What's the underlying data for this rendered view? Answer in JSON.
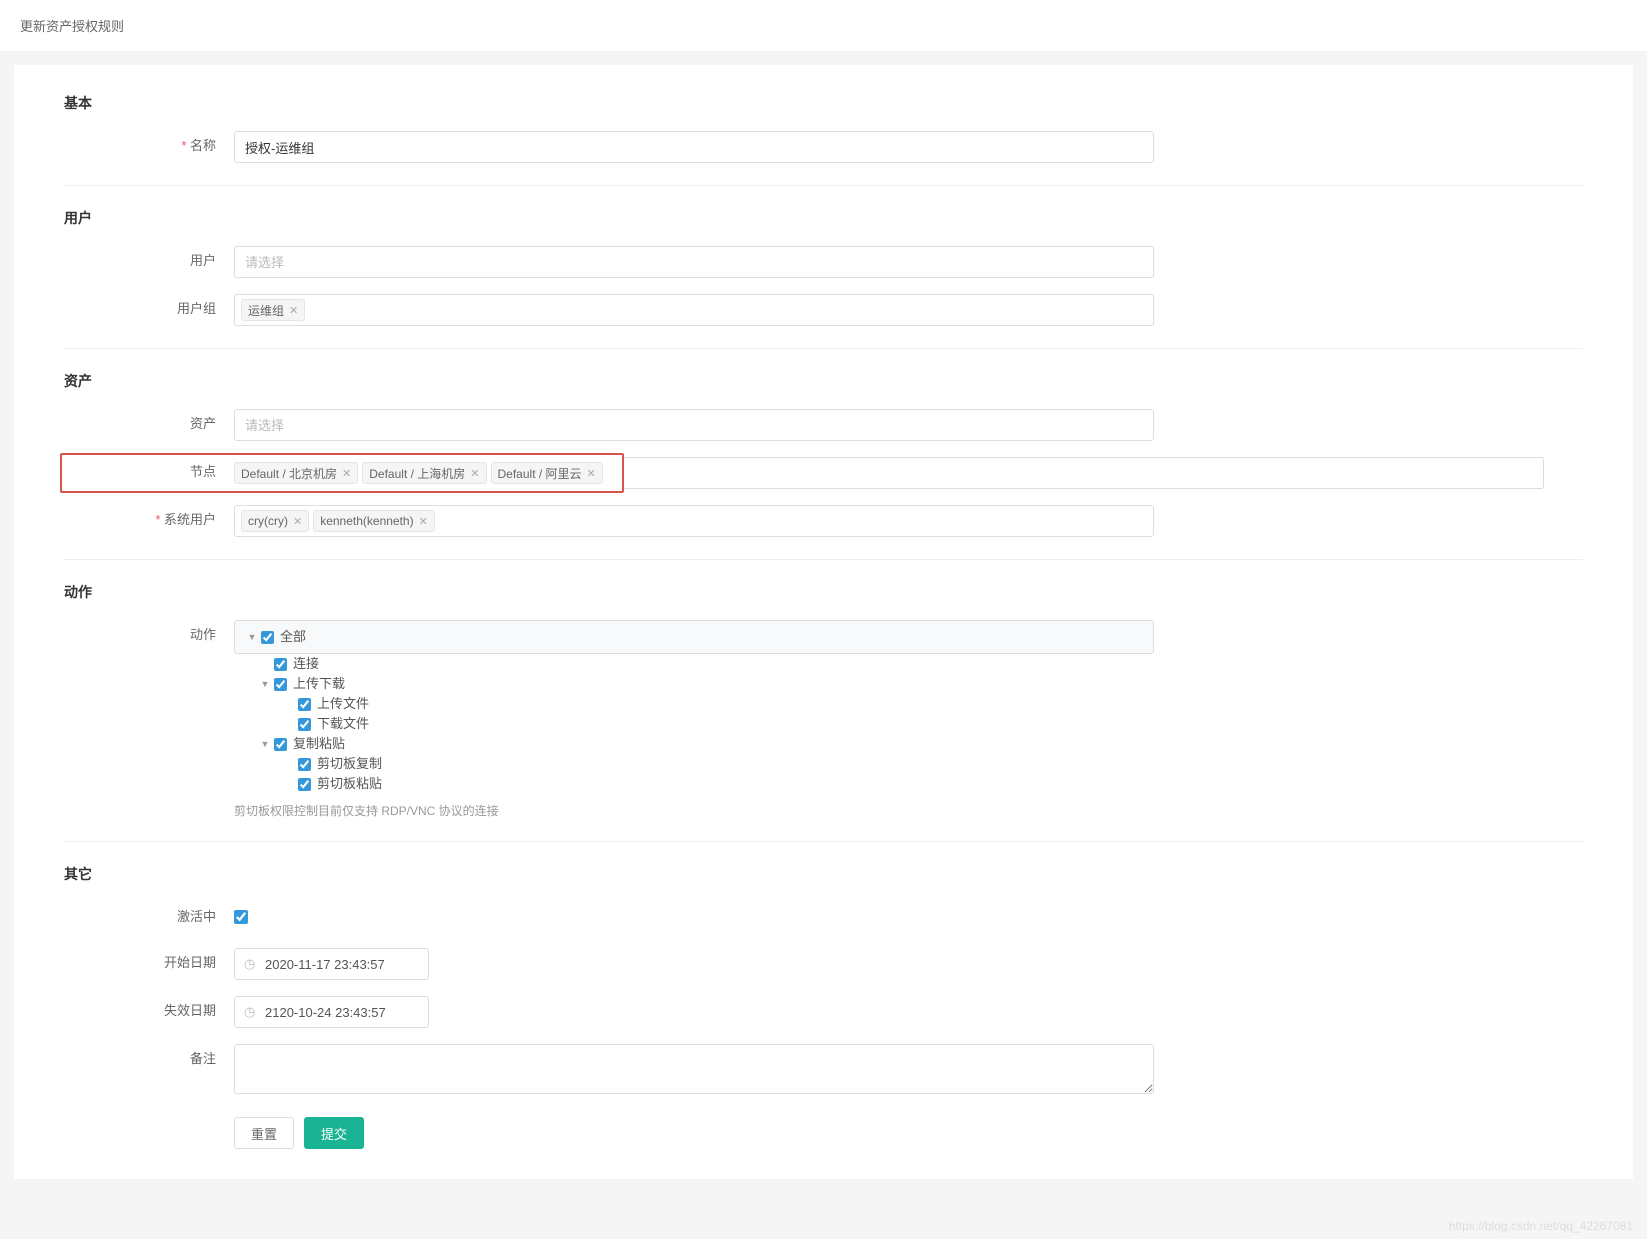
{
  "header": {
    "title": "更新资产授权规则"
  },
  "sections": {
    "basic": {
      "title": "基本",
      "name_label": "名称",
      "name_value": "授权-运维组"
    },
    "user": {
      "title": "用户",
      "user_label": "用户",
      "user_placeholder": "请选择",
      "usergroup_label": "用户组",
      "usergroup_tags": [
        "运维组"
      ]
    },
    "asset": {
      "title": "资产",
      "asset_label": "资产",
      "asset_placeholder": "请选择",
      "node_label": "节点",
      "node_tags": [
        "Default / 北京机房",
        "Default / 上海机房",
        "Default / 阿里云"
      ],
      "sysuser_label": "系统用户",
      "sysuser_tags": [
        "cry(cry)",
        "kenneth(kenneth)"
      ]
    },
    "action": {
      "title": "动作",
      "label": "动作",
      "tree": {
        "all": "全部",
        "connect": "连接",
        "updownload": "上传下载",
        "upload": "上传文件",
        "download": "下载文件",
        "clipboard": "复制粘贴",
        "clip_copy": "剪切板复制",
        "clip_paste": "剪切板粘贴"
      },
      "help": "剪切板权限控制目前仅支持 RDP/VNC 协议的连接"
    },
    "other": {
      "title": "其它",
      "active_label": "激活中",
      "start_label": "开始日期",
      "start_value": "2020-11-17 23:43:57",
      "end_label": "失效日期",
      "end_value": "2120-10-24 23:43:57",
      "remark_label": "备注"
    }
  },
  "buttons": {
    "reset": "重置",
    "submit": "提交"
  },
  "watermark": "https://blog.csdn.net/qq_42267081"
}
